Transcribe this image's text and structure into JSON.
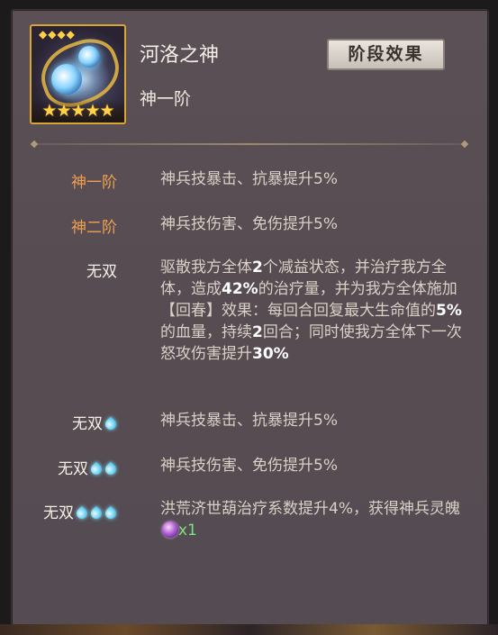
{
  "item": {
    "name": "河洛之神",
    "tier": "神一阶",
    "stars": "★★★★★",
    "crown": "◆◆◆◆"
  },
  "stage_button": "阶段效果",
  "effects": [
    {
      "label": "神一阶",
      "drops": 0,
      "desc": "神兵技暴击、抗暴提升5%"
    },
    {
      "label": "神二阶",
      "drops": 0,
      "desc": "神兵技伤害、免伤提升5%"
    },
    {
      "label": "无双",
      "drops": 0,
      "desc_parts": [
        "驱散我方全体",
        "2",
        "个减益状态，并治疗我方全体，造成",
        "42%",
        "的治疗量，并为我方全体施加【回春】效果：每回合回复最大生命值的",
        "5%",
        "的血量，持续",
        "2",
        "回合；同时使我方全体下一次怒攻伤害提升",
        "30%"
      ]
    },
    {
      "label": "无双",
      "drops": 1,
      "desc": "神兵技暴击、抗暴提升5%"
    },
    {
      "label": "无双",
      "drops": 2,
      "desc": "神兵技伤害、免伤提升5%"
    },
    {
      "label": "无双",
      "drops": 3,
      "desc": "洪荒济世葫治疗系数提升4%，获得神兵灵魄",
      "reward_count": "x1"
    }
  ],
  "colors": {
    "tier_orange": "#f0a150",
    "wushuang_white": "#f3eee6",
    "reward_green": "#7fe07f"
  }
}
